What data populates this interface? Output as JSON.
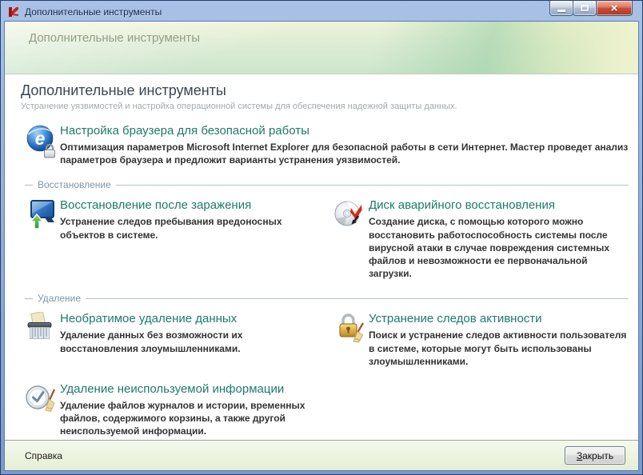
{
  "window": {
    "title": "Дополнительные инструменты",
    "controls": {
      "minimize_icon": "minimize-bar",
      "maximize_icon": "maximize-square",
      "close_glyph": "×"
    },
    "app_icon": "kaspersky-k"
  },
  "banner": {
    "title": "Дополнительные инструменты"
  },
  "main": {
    "heading": "Дополнительные инструменты",
    "subheading": "Устранение уязвимостей и настройка операционной системы для обеспечения надежной защиты данных.",
    "featured": {
      "icon": "ie-browser-lock-icon",
      "title": "Настройка браузера для безопасной работы",
      "desc": "Оптимизация параметров Microsoft Internet Explorer для безопасной работы в сети Интернет. Мастер проведет анализ параметров браузера и предложит варианты устранения уязвимостей."
    },
    "sections": [
      {
        "label": "Восстановление",
        "items": [
          {
            "icon": "monitor-restore-icon",
            "title": "Восстановление после заражения",
            "desc": "Устранение следов пребывания вредоносных объектов в системе."
          },
          {
            "icon": "rescue-disk-icon",
            "title": "Диск аварийного восстановления",
            "desc": "Создание диска, с помощью которого можно восстановить работоспособность системы после вирусной атаки в случае повреждения системных файлов и невозможности ее первоначальной загрузки."
          }
        ]
      },
      {
        "label": "Удаление",
        "items": [
          {
            "icon": "shredder-icon",
            "title": "Необратимое удаление данных",
            "desc": "Удаление данных без возможности их восстановления злоумышленниками."
          },
          {
            "icon": "lock-broom-icon",
            "title": "Устранение следов активности",
            "desc": "Поиск и устранение следов активности пользователя в системе, которые могут быть использованы злоумышленниками."
          },
          {
            "icon": "clock-broom-icon",
            "title": "Удаление неиспользуемой информации",
            "desc": "Удаление файлов журналов и истории, временных файлов, содержимого корзины, а также другой неиспользуемой информации."
          }
        ]
      }
    ]
  },
  "footer": {
    "help_label": "Справка",
    "close_accesskey": "З",
    "close_rest": "акрыть"
  },
  "colors": {
    "title_teal": "#1e7a68",
    "titlebar_blue": "#8da9d6",
    "banner_green": "#ddecd5",
    "footer_green": "#eaf2dc",
    "close_button_red": "#c8503a",
    "section_label": "#7e96a6"
  }
}
